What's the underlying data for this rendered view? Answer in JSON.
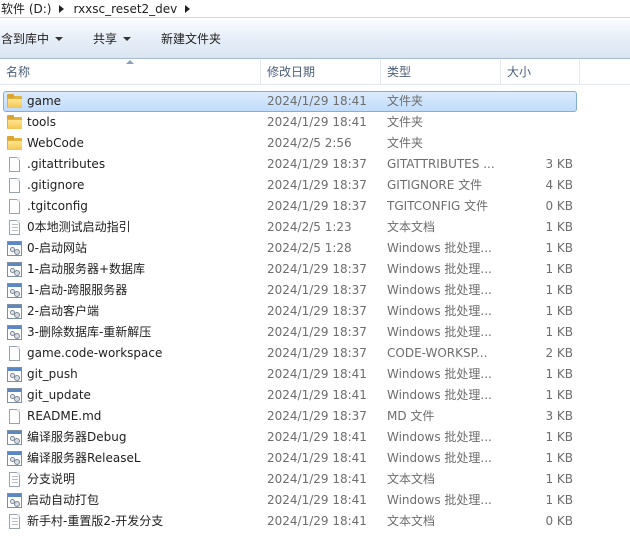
{
  "breadcrumb": [
    "软件 (D:)",
    "rxxsc_reset2_dev"
  ],
  "toolbar": {
    "include_in_library": "含到库中",
    "share": "共享",
    "new_folder": "新建文件夹"
  },
  "columns": {
    "name": "名称",
    "date": "修改日期",
    "type": "类型",
    "size": "大小"
  },
  "files": [
    {
      "name": "game",
      "date": "2024/1/29 18:41",
      "type": "文件夹",
      "size": "",
      "icon": "folder-icon",
      "selected": true
    },
    {
      "name": "tools",
      "date": "2024/1/29 18:41",
      "type": "文件夹",
      "size": "",
      "icon": "folder-icon"
    },
    {
      "name": "WebCode",
      "date": "2024/2/5 2:56",
      "type": "文件夹",
      "size": "",
      "icon": "folder-icon"
    },
    {
      "name": ".gitattributes",
      "date": "2024/1/29 18:37",
      "type": "GITATTRIBUTES ...",
      "size": "3 KB",
      "icon": "document-icon"
    },
    {
      "name": ".gitignore",
      "date": "2024/1/29 18:37",
      "type": "GITIGNORE 文件",
      "size": "4 KB",
      "icon": "document-icon"
    },
    {
      "name": ".tgitconfig",
      "date": "2024/1/29 18:37",
      "type": "TGITCONFIG 文件",
      "size": "0 KB",
      "icon": "document-icon"
    },
    {
      "name": "0本地测试启动指引",
      "date": "2024/2/5 1:23",
      "type": "文本文档",
      "size": "1 KB",
      "icon": "text-icon"
    },
    {
      "name": "0-启动网站",
      "date": "2024/2/5 1:28",
      "type": "Windows 批处理...",
      "size": "1 KB",
      "icon": "batch-icon"
    },
    {
      "name": "1-启动服务器+数据库",
      "date": "2024/1/29 18:37",
      "type": "Windows 批处理...",
      "size": "1 KB",
      "icon": "batch-icon"
    },
    {
      "name": "1-启动-跨服服务器",
      "date": "2024/1/29 18:37",
      "type": "Windows 批处理...",
      "size": "1 KB",
      "icon": "batch-icon"
    },
    {
      "name": "2-启动客户端",
      "date": "2024/1/29 18:37",
      "type": "Windows 批处理...",
      "size": "1 KB",
      "icon": "batch-icon"
    },
    {
      "name": "3-删除数据库-重新解压",
      "date": "2024/1/29 18:37",
      "type": "Windows 批处理...",
      "size": "1 KB",
      "icon": "batch-icon"
    },
    {
      "name": "game.code-workspace",
      "date": "2024/1/29 18:37",
      "type": "CODE-WORKSP...",
      "size": "2 KB",
      "icon": "document-icon"
    },
    {
      "name": "git_push",
      "date": "2024/1/29 18:41",
      "type": "Windows 批处理...",
      "size": "1 KB",
      "icon": "batch-icon"
    },
    {
      "name": "git_update",
      "date": "2024/1/29 18:41",
      "type": "Windows 批处理...",
      "size": "1 KB",
      "icon": "batch-icon"
    },
    {
      "name": "README.md",
      "date": "2024/1/29 18:37",
      "type": "MD 文件",
      "size": "3 KB",
      "icon": "document-icon"
    },
    {
      "name": "编译服务器Debug",
      "date": "2024/1/29 18:41",
      "type": "Windows 批处理...",
      "size": "1 KB",
      "icon": "batch-icon"
    },
    {
      "name": "编译服务器ReleaseL",
      "date": "2024/1/29 18:41",
      "type": "Windows 批处理...",
      "size": "1 KB",
      "icon": "batch-icon"
    },
    {
      "name": "分支说明",
      "date": "2024/1/29 18:41",
      "type": "文本文档",
      "size": "1 KB",
      "icon": "text-icon"
    },
    {
      "name": "启动自动打包",
      "date": "2024/1/29 18:41",
      "type": "Windows 批处理...",
      "size": "1 KB",
      "icon": "batch-icon"
    },
    {
      "name": "新手村-重置版2-开发分支",
      "date": "2024/1/29 18:41",
      "type": "文本文档",
      "size": "0 KB",
      "icon": "text-icon"
    }
  ]
}
